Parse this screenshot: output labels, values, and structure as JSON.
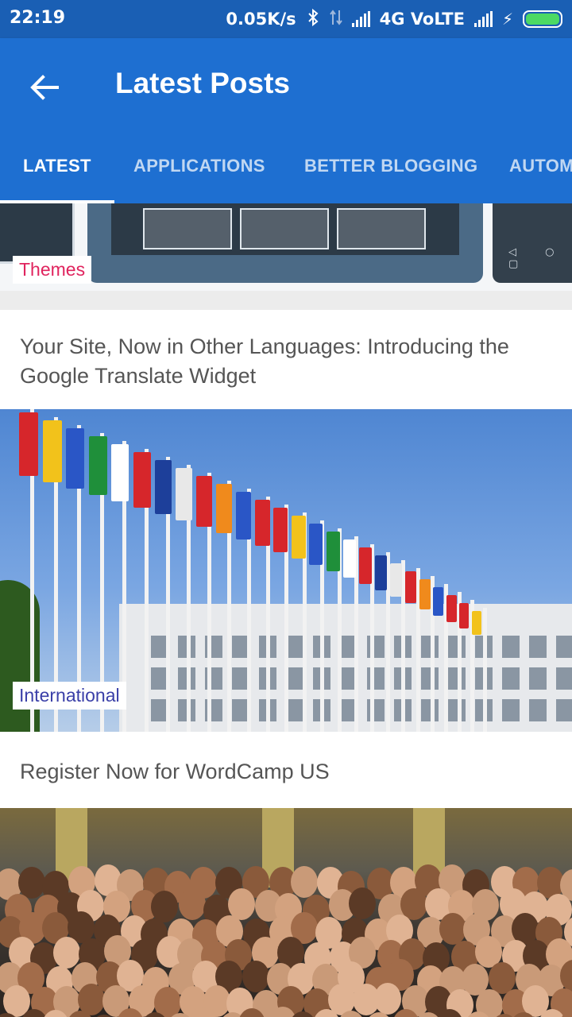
{
  "status_bar": {
    "time": "22:19",
    "net_speed": "0.05K/s",
    "network": "4G VoLTE",
    "icons": [
      "bluetooth-icon",
      "data-arrows-icon",
      "signal-icon",
      "signal-icon",
      "charging-bolt-icon",
      "battery-icon"
    ]
  },
  "app_bar": {
    "title": "Latest Posts",
    "back_icon": "arrow-left-icon",
    "color": "#1e6fd1"
  },
  "tabs": [
    {
      "label": "LATEST",
      "active": true
    },
    {
      "label": "APPLICATIONS",
      "active": false
    },
    {
      "label": "BETTER BLOGGING",
      "active": false
    },
    {
      "label": "AUTOM",
      "active": false
    }
  ],
  "posts": [
    {
      "category": "Themes",
      "category_color": "#e0245e"
    },
    {
      "headline": "Your Site, Now in Other Languages: Introducing the Google Translate Widget",
      "category": "International",
      "category_color": "#3a3fa8"
    },
    {
      "headline": "Register Now for WordCamp US"
    }
  ]
}
